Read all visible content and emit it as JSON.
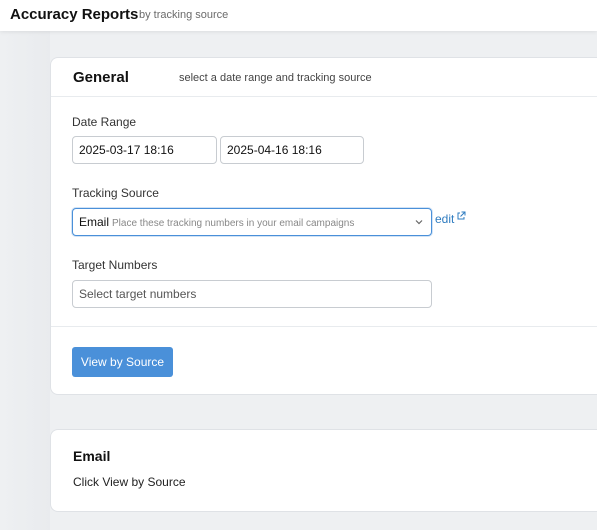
{
  "header": {
    "title": "Accuracy Reports",
    "subtitle": "by tracking source"
  },
  "general": {
    "title": "General",
    "subtitle": "select a date range and tracking source",
    "date_range": {
      "label": "Date Range",
      "start": "2025-03-17 18:16",
      "end": "2025-04-16 18:16"
    },
    "tracking_source": {
      "label": "Tracking Source",
      "selected": "Email",
      "hint": "Place these tracking numbers in your email campaigns",
      "edit_label": "edit"
    },
    "target_numbers": {
      "label": "Target Numbers",
      "placeholder": "Select target numbers"
    },
    "view_button_label": "View by Source"
  },
  "email": {
    "title": "Email",
    "body": "Click View by Source"
  },
  "colors": {
    "accent": "#4a90d9",
    "link": "#2f7cc0",
    "background": "#eef0f2"
  },
  "icons": [
    "chevron-down-icon",
    "external-link-icon"
  ]
}
